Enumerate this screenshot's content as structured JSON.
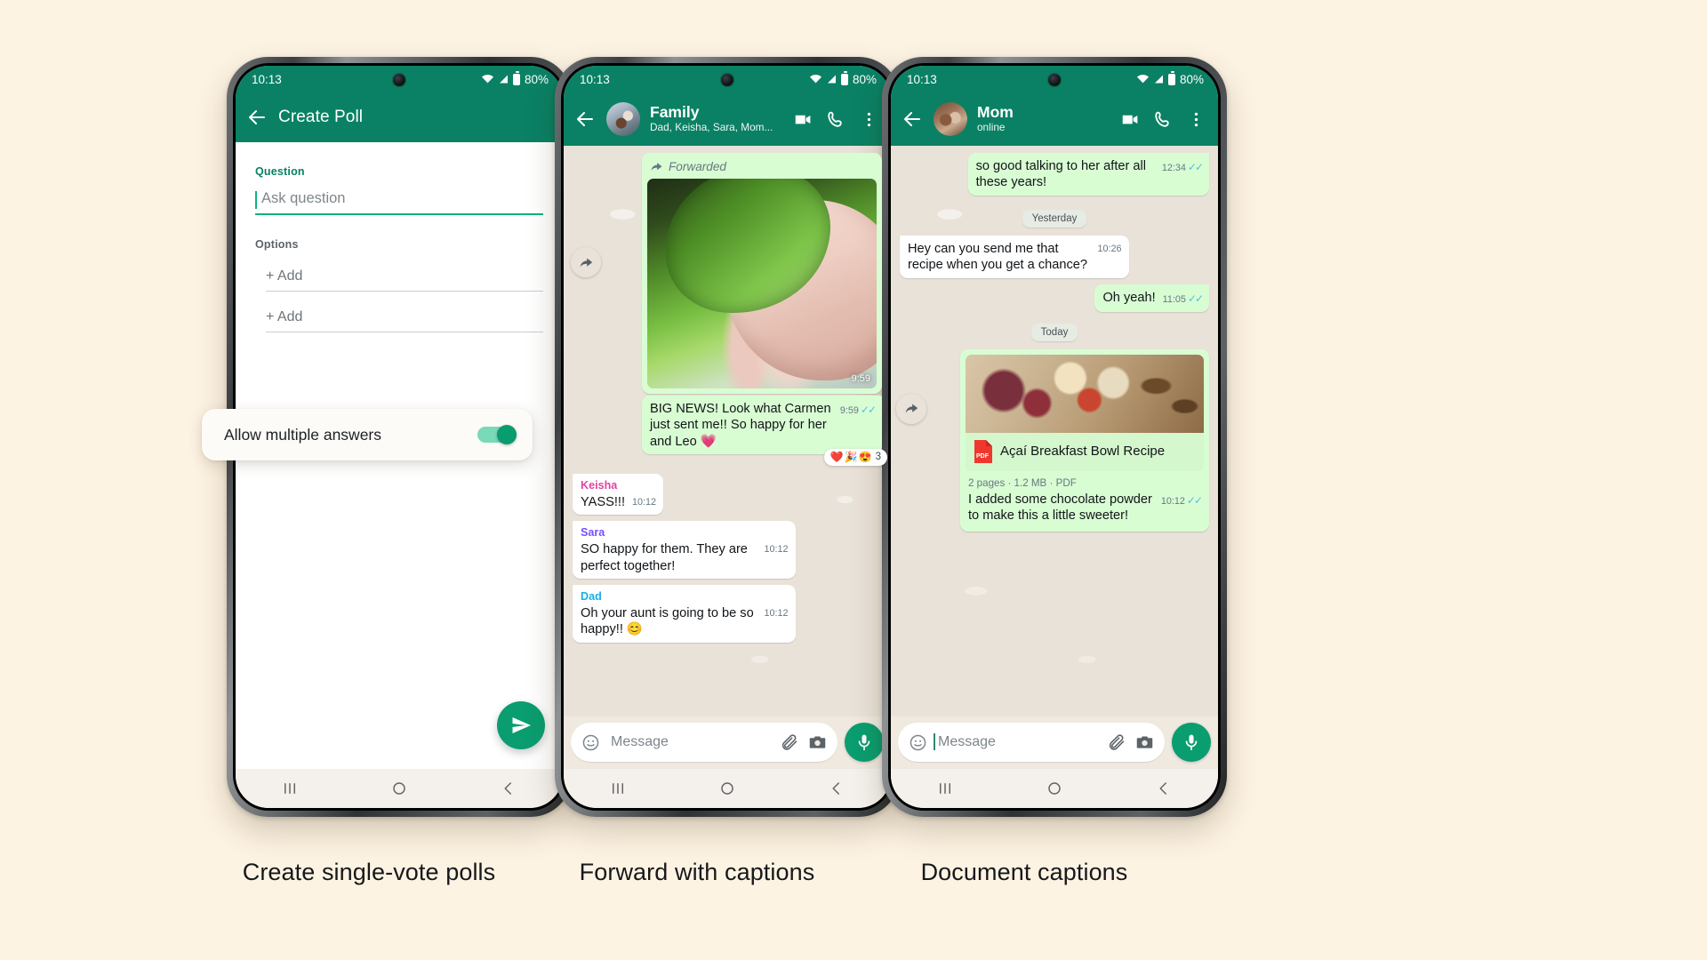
{
  "page": {
    "background": "#fdf3e3",
    "accent": "#0a8164"
  },
  "captions": {
    "one": "Create single-vote polls",
    "two": "Forward with captions",
    "three": "Document captions"
  },
  "status": {
    "time": "10:13",
    "battery": "80%"
  },
  "phone1": {
    "appbar": {
      "title": "Create Poll",
      "back_icon": "back-arrow-icon"
    },
    "poll": {
      "question_label": "Question",
      "question_placeholder": "Ask question",
      "options_label": "Options",
      "option_add_1": "+ Add",
      "option_add_2": "+ Add",
      "send_icon": "send-icon"
    },
    "callout": {
      "label": "Allow multiple answers",
      "toggle_state": "on",
      "toggle_color": "#089c6f"
    }
  },
  "phone2": {
    "appbar": {
      "name": "Family",
      "subtitle": "Dad, Keisha, Sara, Mom...",
      "video_icon": "video-call-icon",
      "call_icon": "phone-call-icon",
      "menu_icon": "overflow-menu-icon"
    },
    "forwarded": {
      "tag": "Forwarded",
      "media_time": "9:59",
      "caption": "BIG NEWS! Look what Carmen just sent me!! So happy for her and Leo 💗",
      "time": "9:59",
      "ticks": "✓✓",
      "reactions": [
        "❤️",
        "🎉",
        "😍"
      ],
      "reaction_count": "3"
    },
    "messages": [
      {
        "sender": "Keisha",
        "sender_color": "#e542a3",
        "text": "YASS!!!",
        "time": "10:12"
      },
      {
        "sender": "Sara",
        "sender_color": "#7c4dff",
        "text": "SO happy for them. They are perfect together!",
        "time": "10:12"
      },
      {
        "sender": "Dad",
        "sender_color": "#1aaee5",
        "text": "Oh your aunt is going to be so happy!! 😊",
        "time": "10:12"
      }
    ],
    "input": {
      "placeholder": "Message",
      "emoji_icon": "emoji-icon",
      "attach_icon": "paperclip-icon",
      "camera_icon": "camera-icon",
      "mic_icon": "microphone-icon"
    }
  },
  "phone3": {
    "appbar": {
      "name": "Mom",
      "subtitle": "online",
      "video_icon": "video-call-icon",
      "call_icon": "phone-call-icon",
      "menu_icon": "overflow-menu-icon"
    },
    "messages": [
      {
        "dir": "out",
        "text": "so good talking to her after all these years!",
        "time": "12:34",
        "ticks": "✓✓"
      },
      {
        "dir": "day",
        "text": "Yesterday"
      },
      {
        "dir": "in",
        "text": "Hey can you send me that recipe when you get a chance?",
        "time": "10:26"
      },
      {
        "dir": "out",
        "text": "Oh yeah!",
        "time": "11:05",
        "ticks": "✓✓"
      },
      {
        "dir": "day",
        "text": "Today"
      }
    ],
    "document": {
      "title": "Açaí Breakfast Bowl Recipe",
      "file_icon": "pdf-file-icon",
      "meta": "2 pages · 1.2 MB · PDF",
      "caption": "I added some chocolate powder to make this a little sweeter!",
      "time": "10:12",
      "ticks": "✓✓"
    },
    "input": {
      "placeholder": "Message",
      "emoji_icon": "emoji-icon",
      "attach_icon": "paperclip-icon",
      "camera_icon": "camera-icon",
      "mic_icon": "microphone-icon"
    }
  },
  "navbar": {
    "recents_icon": "recents-icon",
    "home_icon": "home-icon",
    "back_icon": "back-nav-icon"
  }
}
